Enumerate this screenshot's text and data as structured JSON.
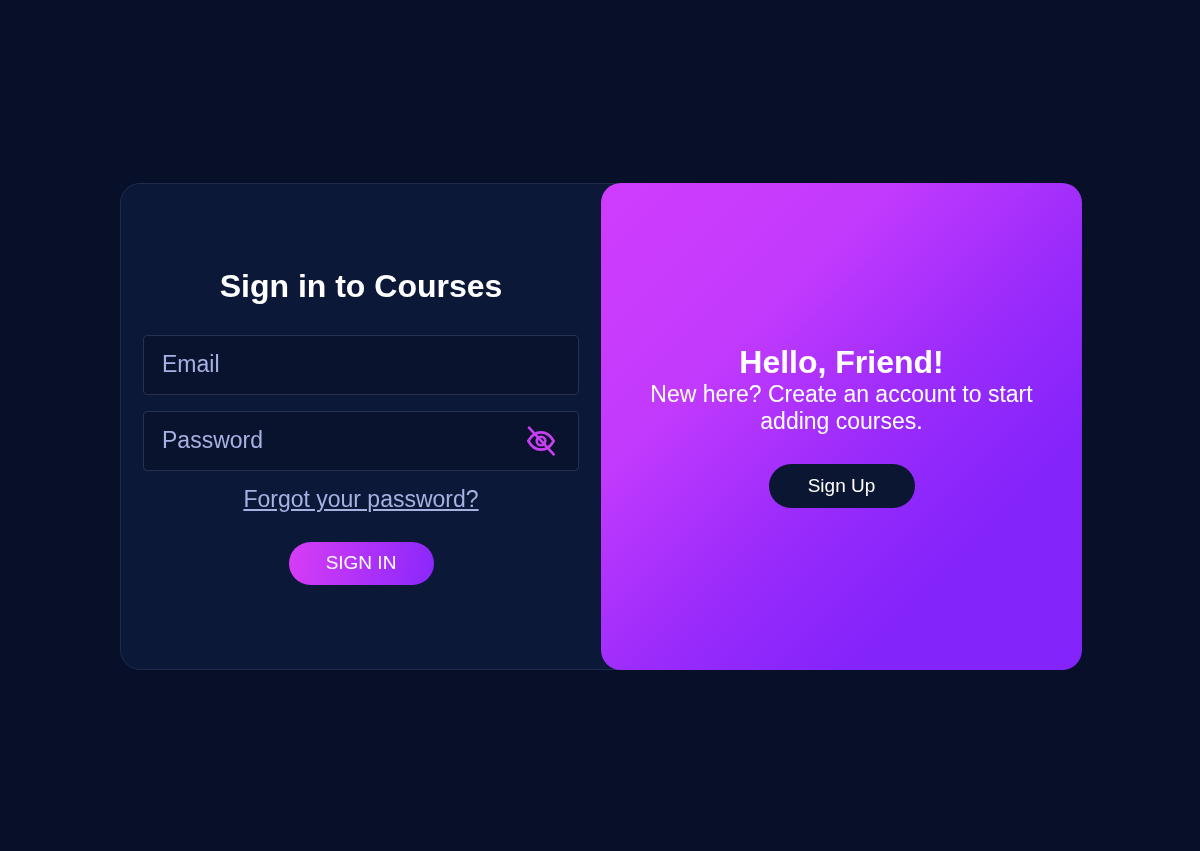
{
  "signin": {
    "title": "Sign in to Courses",
    "fields": [
      {
        "kind": "email",
        "placeholder": "Email"
      },
      {
        "kind": "password",
        "placeholder": "Password"
      }
    ],
    "forgot_link": "Forgot your password?",
    "button": "SIGN IN"
  },
  "welcome": {
    "title": "Hello, Friend!",
    "text": "New here? Create an account to start adding courses.",
    "button": "Sign Up"
  }
}
